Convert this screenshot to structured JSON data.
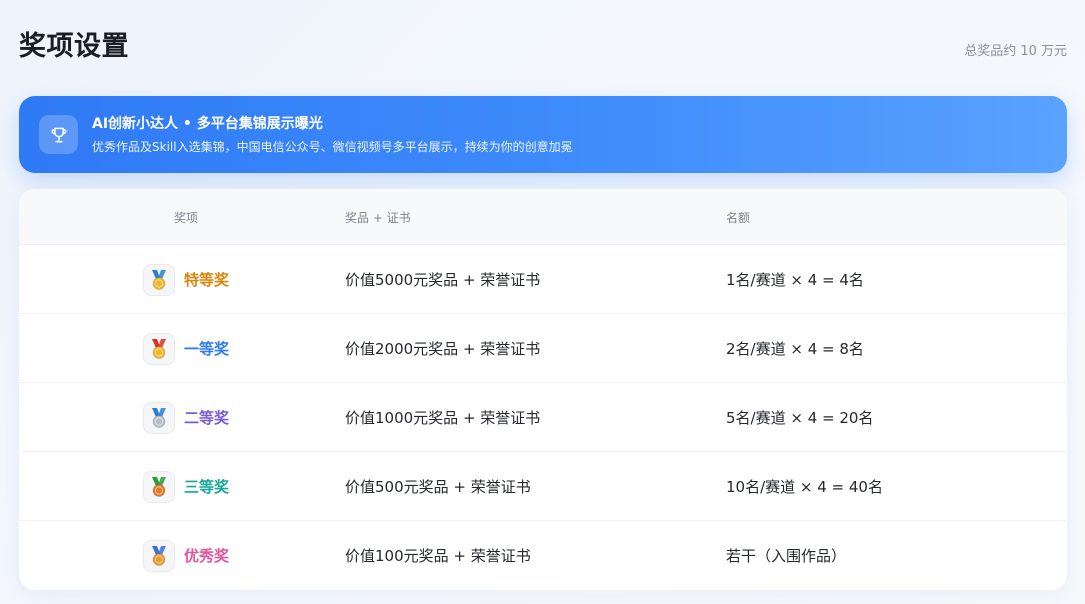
{
  "header": {
    "title": "奖项设置",
    "total": "总奖品约 10 万元"
  },
  "banner": {
    "icon": "trophy-icon",
    "title": "AI创新小达人 • 多平台集锦展示曝光",
    "subtitle": "优秀作品及Skill入选集锦，中国电信公众号、微信视频号多平台展示，持续为你的创意加冕"
  },
  "table": {
    "headers": {
      "award": "奖项",
      "prize": "奖品 + 证书",
      "quota": "名额"
    },
    "rows": [
      {
        "name": "特等奖",
        "color": "#d9860d",
        "icon": "medal-icon",
        "ribbon": "#2a7fd4",
        "medalColor": "#f0b62a",
        "prize": "价值5000元奖品 + 荣誉证书",
        "quota": "1名/赛道 × 4 = 4名"
      },
      {
        "name": "一等奖",
        "color": "#2f7af5",
        "icon": "medal-icon",
        "ribbon": "#d8342b",
        "medalColor": "#f0b62a",
        "prize": "价值2000元奖品 + 荣誉证书",
        "quota": "2名/赛道 × 4 = 8名"
      },
      {
        "name": "二等奖",
        "color": "#7b5bd6",
        "icon": "medal-icon",
        "ribbon": "#2a7fd4",
        "medalColor": "#b9bec6",
        "prize": "价值1000元奖品 + 荣誉证书",
        "quota": "5名/赛道 × 4 = 20名"
      },
      {
        "name": "三等奖",
        "color": "#15a894",
        "icon": "medal-icon",
        "ribbon": "#2f9a3a",
        "medalColor": "#e07a2a",
        "prize": "价值500元奖品 + 荣誉证书",
        "quota": "10名/赛道 × 4 = 40名"
      },
      {
        "name": "优秀奖",
        "color": "#e2559e",
        "icon": "medal-icon",
        "ribbon": "#3b6fd4",
        "medalColor": "#e79a2c",
        "prize": "价值100元奖品 + 荣誉证书",
        "quota": "若干（入围作品）"
      }
    ]
  }
}
